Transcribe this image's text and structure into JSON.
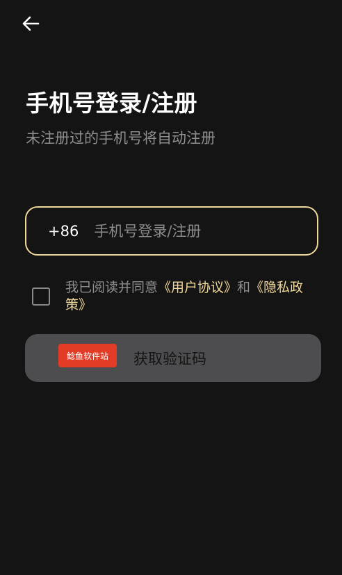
{
  "header": {
    "back_icon": "arrow-left-icon",
    "title": "手机号登录/注册",
    "subtitle": "未注册过的手机号将自动注册"
  },
  "phone": {
    "country_code": "+86",
    "placeholder": "手机号登录/注册",
    "value": ""
  },
  "agreement": {
    "checked": false,
    "prefix": "我已阅读并同意",
    "user_agreement": "《用户协议》",
    "and": "和",
    "privacy_policy": "《隐私政策》"
  },
  "submit": {
    "label": "获取验证码"
  },
  "watermark": {
    "text": "鲶鱼软件站"
  },
  "colors": {
    "background": "#141414",
    "accent": "#f0d79a",
    "button_bg": "#4d4d4f",
    "muted_text": "#8e8e8e",
    "badge_bg": "#e23b26"
  }
}
